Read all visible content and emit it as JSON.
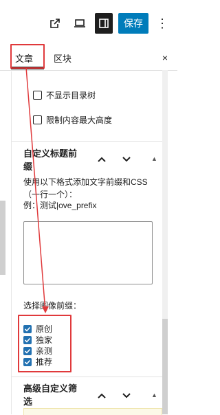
{
  "toolbar": {
    "save_label": "保存",
    "more_label": "⋮"
  },
  "tabs": {
    "post": "文章",
    "block": "区块",
    "close": "×"
  },
  "options": [
    {
      "label": "不显示目录树"
    },
    {
      "label": "限制内容最大高度"
    }
  ],
  "section_prefix": {
    "title": "自定义标题前缀",
    "description": "使用以下格式添加文字前缀和CSS（一行一个）：",
    "example": "例：测试|ove_prefix",
    "image_prefix_label": "选择图像前缀：",
    "image_prefix_options": [
      {
        "label": "原创"
      },
      {
        "label": "独家"
      },
      {
        "label": "亲测"
      },
      {
        "label": "推荐"
      }
    ]
  },
  "section_filter": {
    "title": "高级自定义筛选"
  },
  "colors": {
    "accent": "#007cba",
    "annotation": "#e0393b",
    "checkbox": "#2271b1"
  },
  "icons": [
    "external-link-icon",
    "laptop-icon",
    "sidebar-icon",
    "chevron-up-icon",
    "chevron-down-icon",
    "collapse-triangle-icon",
    "check-icon"
  ]
}
